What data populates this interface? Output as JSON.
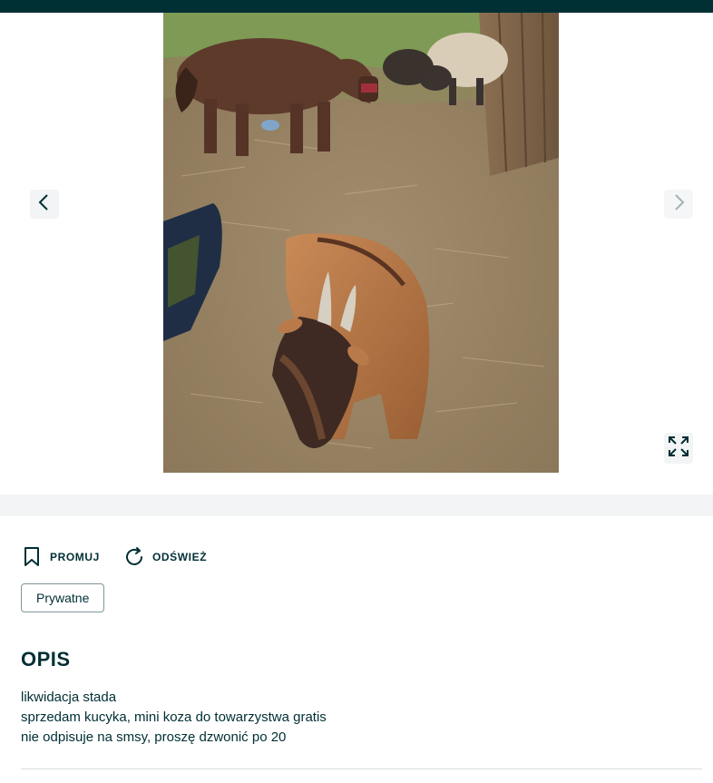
{
  "gallery": {
    "photo_subject": "goat, pony and sheep in a farmyard",
    "prev_icon": "chevron-left-icon",
    "next_icon": "chevron-right-icon",
    "fullscreen_icon": "expand-icon"
  },
  "actions": [
    {
      "label": "PROMUJ",
      "icon": "bookmark-icon"
    },
    {
      "label": "ODŚWIEŻ",
      "icon": "refresh-icon"
    }
  ],
  "badge": {
    "label": "Prywatne"
  },
  "description": {
    "title": "OPIS",
    "lines": [
      "likwidacja stada",
      "sprzedam kucyka, mini koza do towarzystwa gratis",
      "nie odpisuje na smsy, proszę dzwonić po 20"
    ]
  },
  "colors": {
    "primary_text": "#002f34",
    "band": "#f2f4f5",
    "border": "#7f9799"
  }
}
